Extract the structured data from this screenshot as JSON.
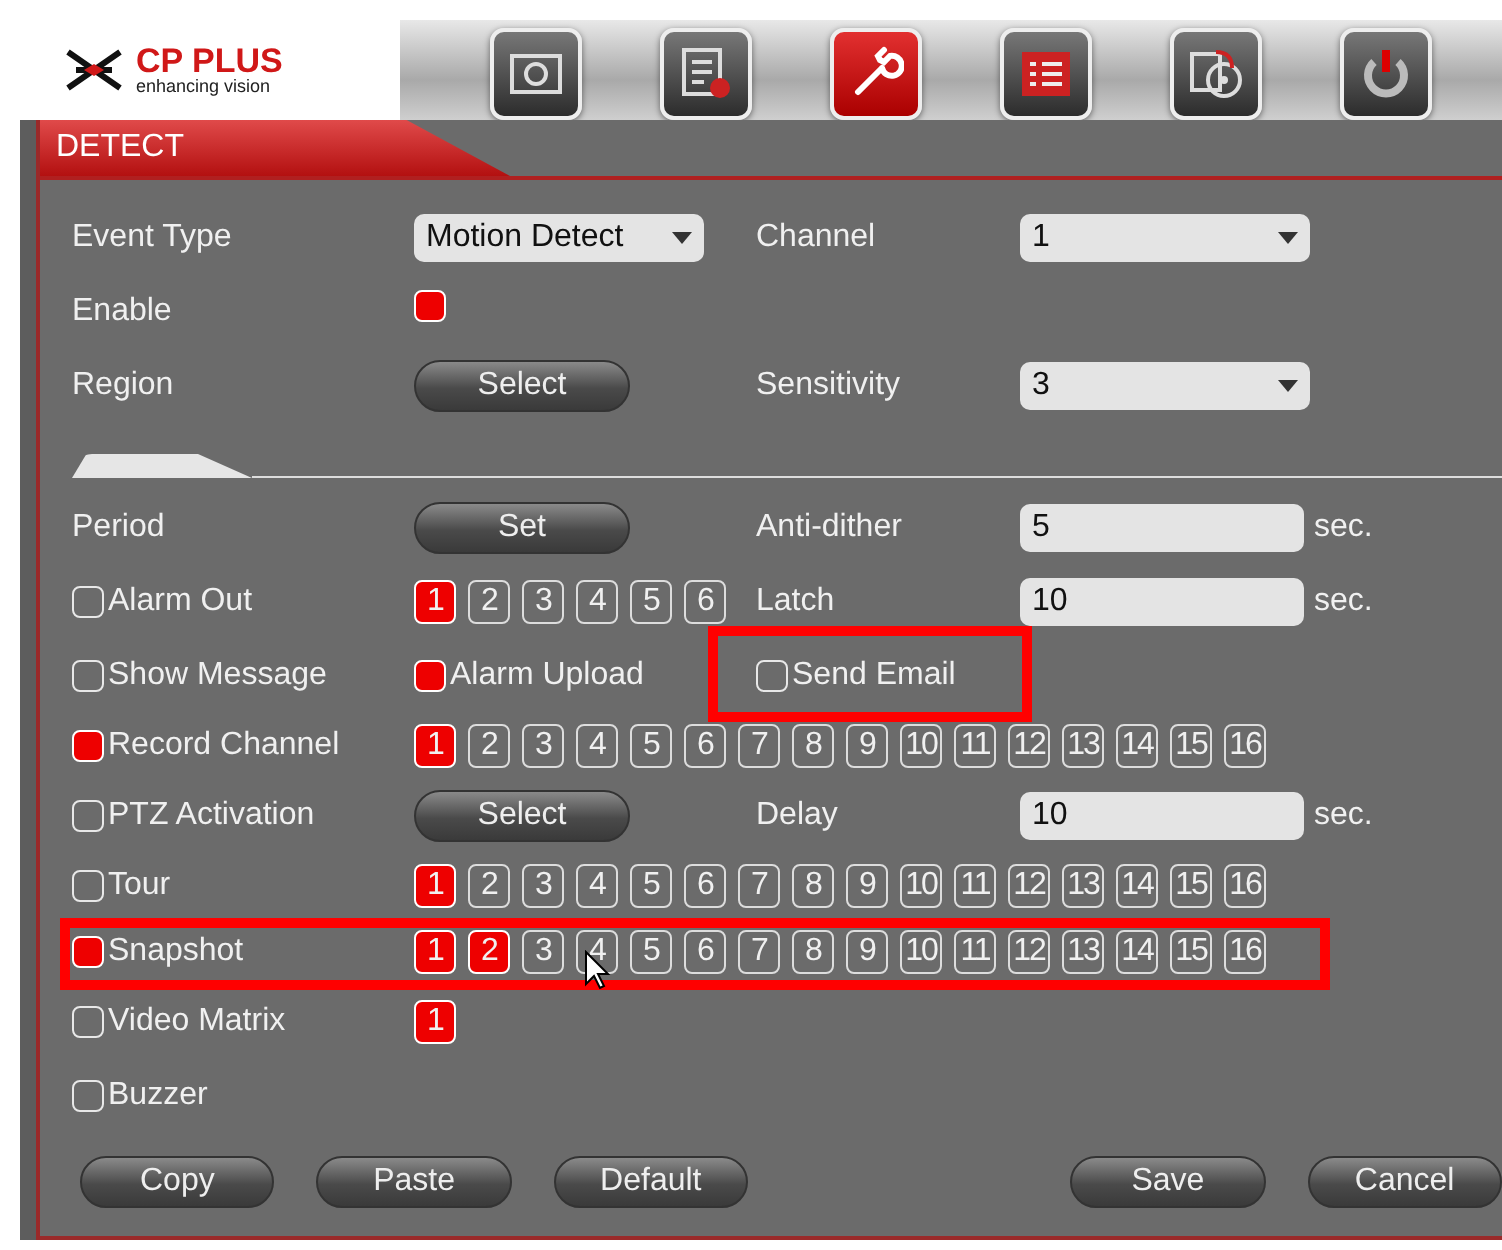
{
  "logo": {
    "name": "CP PLUS",
    "tagline": "enhancing vision"
  },
  "toolbar": [
    {
      "kind": "camera",
      "selected": false
    },
    {
      "kind": "document",
      "selected": false
    },
    {
      "kind": "wrench",
      "selected": true
    },
    {
      "kind": "list",
      "selected": false
    },
    {
      "kind": "disc",
      "selected": false
    },
    {
      "kind": "power",
      "selected": false
    }
  ],
  "tab": "DETECT",
  "settings": [
    {
      "label": "Event Type",
      "cells": [
        {
          "kind": "dropdown",
          "value": "Motion Detect"
        },
        {
          "kind": "label",
          "text": "Channel"
        },
        {
          "kind": "dropdown",
          "value": "1"
        }
      ]
    },
    {
      "label": "Enable",
      "cells": [
        {
          "kind": "checkbox",
          "checked": true
        }
      ]
    },
    {
      "label": "Region",
      "cells": [
        {
          "kind": "button",
          "text": "Select"
        },
        {
          "kind": "label",
          "text": "Sensitivity"
        },
        {
          "kind": "dropdown",
          "value": "3"
        }
      ]
    },
    {
      "kind": "divider"
    },
    {
      "label": "Period",
      "cells": [
        {
          "kind": "button",
          "text": "Set"
        },
        {
          "kind": "label",
          "text": "Anti-dither"
        },
        {
          "kind": "field",
          "value": "5",
          "unit": "sec."
        }
      ]
    },
    {
      "label": "Alarm Out",
      "checked": false,
      "cells": [
        {
          "kind": "chips",
          "items": [
            {
              "text": "1",
              "selected": true
            },
            {
              "text": "2",
              "selected": false
            },
            {
              "text": "3",
              "selected": false
            },
            {
              "text": "4",
              "selected": false
            },
            {
              "text": "5",
              "selected": false
            },
            {
              "text": "6",
              "selected": false
            }
          ]
        },
        {
          "kind": "label",
          "text": "Latch"
        },
        {
          "kind": "field",
          "value": "10",
          "unit": "sec."
        }
      ]
    },
    {
      "label": "Show Message",
      "checked": false,
      "cells": [
        {
          "kind": "option",
          "text": "Alarm Upload",
          "checked": true,
          "highlight": false
        },
        {
          "kind": "option",
          "text": "Send Email",
          "checked": false,
          "highlight": true
        }
      ]
    },
    {
      "label": "Record Channel",
      "checked": true,
      "cells": [
        {
          "kind": "chips",
          "items": [
            {
              "text": "1",
              "selected": true
            },
            {
              "text": "2",
              "selected": false
            },
            {
              "text": "3",
              "selected": false
            },
            {
              "text": "4",
              "selected": false
            },
            {
              "text": "5",
              "selected": false
            },
            {
              "text": "6",
              "selected": false
            },
            {
              "text": "7",
              "selected": false
            },
            {
              "text": "8",
              "selected": false
            },
            {
              "text": "9",
              "selected": false
            },
            {
              "text": "10",
              "selected": false
            },
            {
              "text": "11",
              "selected": false
            },
            {
              "text": "12",
              "selected": false
            },
            {
              "text": "13",
              "selected": false
            },
            {
              "text": "14",
              "selected": false
            },
            {
              "text": "15",
              "selected": false
            },
            {
              "text": "16",
              "selected": false
            }
          ]
        }
      ]
    },
    {
      "label": "PTZ Activation",
      "checked": false,
      "cells": [
        {
          "kind": "button",
          "text": "Select"
        },
        {
          "kind": "label",
          "text": "Delay"
        },
        {
          "kind": "field",
          "value": "10",
          "unit": "sec."
        }
      ]
    },
    {
      "label": "Tour",
      "checked": false,
      "cells": [
        {
          "kind": "chips",
          "items": [
            {
              "text": "1",
              "selected": true
            },
            {
              "text": "2",
              "selected": false
            },
            {
              "text": "3",
              "selected": false
            },
            {
              "text": "4",
              "selected": false
            },
            {
              "text": "5",
              "selected": false
            },
            {
              "text": "6",
              "selected": false
            },
            {
              "text": "7",
              "selected": false
            },
            {
              "text": "8",
              "selected": false
            },
            {
              "text": "9",
              "selected": false
            },
            {
              "text": "10",
              "selected": false
            },
            {
              "text": "11",
              "selected": false
            },
            {
              "text": "12",
              "selected": false
            },
            {
              "text": "13",
              "selected": false
            },
            {
              "text": "14",
              "selected": false
            },
            {
              "text": "15",
              "selected": false
            },
            {
              "text": "16",
              "selected": false
            }
          ]
        }
      ]
    },
    {
      "label": "Snapshot",
      "checked": true,
      "highlight": true,
      "cells": [
        {
          "kind": "chips",
          "items": [
            {
              "text": "1",
              "selected": true
            },
            {
              "text": "2",
              "selected": true
            },
            {
              "text": "3",
              "selected": false
            },
            {
              "text": "4",
              "selected": false
            },
            {
              "text": "5",
              "selected": false
            },
            {
              "text": "6",
              "selected": false
            },
            {
              "text": "7",
              "selected": false
            },
            {
              "text": "8",
              "selected": false
            },
            {
              "text": "9",
              "selected": false
            },
            {
              "text": "10",
              "selected": false
            },
            {
              "text": "11",
              "selected": false
            },
            {
              "text": "12",
              "selected": false
            },
            {
              "text": "13",
              "selected": false
            },
            {
              "text": "14",
              "selected": false
            },
            {
              "text": "15",
              "selected": false
            },
            {
              "text": "16",
              "selected": false
            }
          ]
        }
      ]
    },
    {
      "label": "Video Matrix",
      "checked": false,
      "cells": [
        {
          "kind": "chips",
          "items": [
            {
              "text": "1",
              "selected": true
            }
          ]
        }
      ]
    },
    {
      "label": "Buzzer",
      "checked": false
    }
  ],
  "buttons_left": [
    "Copy",
    "Paste",
    "Default"
  ],
  "buttons_right": [
    "Save",
    "Cancel"
  ]
}
